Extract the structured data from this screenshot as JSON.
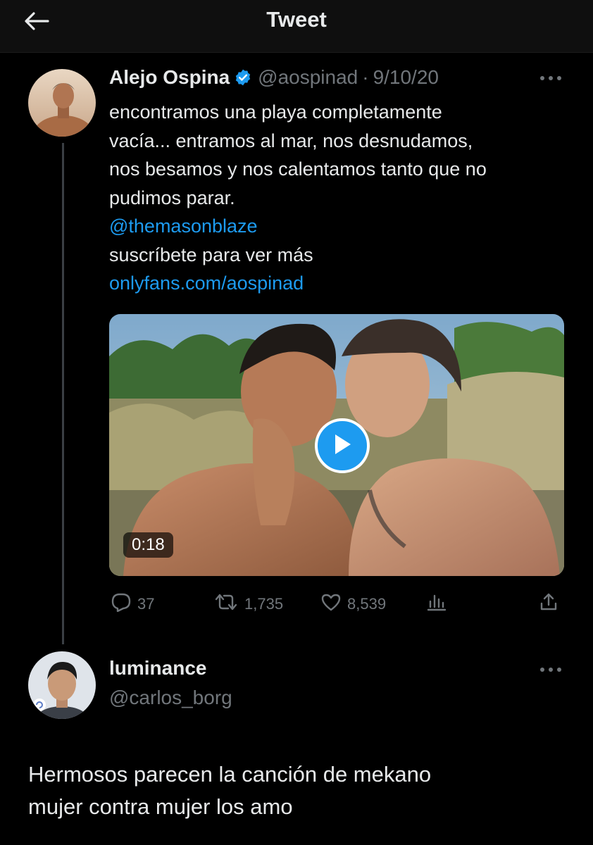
{
  "header": {
    "title": "Tweet"
  },
  "tweet": {
    "author_name": "Alejo Ospina",
    "author_handle": "@aospinad",
    "separator": "·",
    "date": "9/10/20",
    "text_lines": [
      "encontramos una playa completamente",
      "vacía... entramos al mar, nos desnudamos,",
      "nos besamos y nos calentamos tanto que no",
      "pudimos parar."
    ],
    "mention": "@themasonblaze",
    "cta": "suscríbete para ver más",
    "link": "onlyfans.com/aospinad",
    "video": {
      "duration": "0:18"
    },
    "stats": {
      "replies": "37",
      "retweets": "1,735",
      "likes": "8,539"
    }
  },
  "reply": {
    "author_name": "luminance",
    "author_handle": "@carlos_borg",
    "text_lines": [
      "Hermosos parecen la canción de mekano",
      "mujer contra mujer los amo"
    ]
  },
  "icons": {
    "back": "arrow-left-icon",
    "verified": "verified-badge-icon",
    "more": "more-horizontal-icon",
    "play": "play-icon",
    "reply": "reply-icon",
    "retweet": "retweet-icon",
    "like": "heart-icon",
    "analytics": "analytics-icon",
    "share": "share-icon"
  },
  "colors": {
    "background": "#000000",
    "accent": "#1d9bf0",
    "muted": "#71767b",
    "text": "#e7e9ea"
  }
}
